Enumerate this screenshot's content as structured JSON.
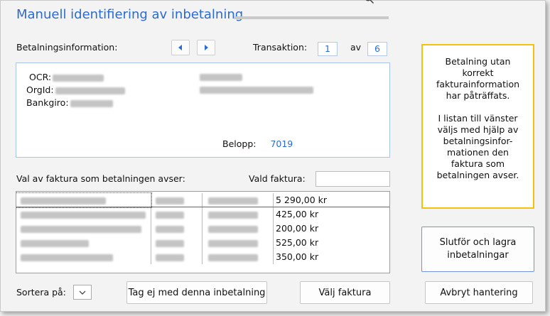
{
  "header": {
    "title": "Manuell identifiering av inbetalning"
  },
  "payment": {
    "section_label": "Betalningsinformation:",
    "transaction_label": "Transaktion:",
    "transaction_current": "1",
    "of_label": "av",
    "transaction_total": "6",
    "ocr_label": "OCR:",
    "orgid_label": "OrgId:",
    "bankgiro_label": "Bankgiro:",
    "amount_label": "Belopp:",
    "amount_value": "7019"
  },
  "invoice_selection": {
    "label": "Val av faktura som betalningen avser:",
    "selected_label": "Vald faktura:",
    "selected_value": "",
    "rows": [
      {
        "amount": "5 290,00 kr",
        "selected": true
      },
      {
        "amount": "425,00 kr"
      },
      {
        "amount": "200,00 kr"
      },
      {
        "amount": "525,00 kr"
      },
      {
        "amount": "350,00 kr"
      }
    ]
  },
  "info_box": {
    "lines": [
      "Betalning utan",
      "korrekt",
      "fakturainformation",
      "har påträffats.",
      "",
      "I listan till vänster",
      "väljs med hjälp av",
      "betalningsinfor-",
      "mationen den",
      "faktura som",
      "betalningen avser."
    ]
  },
  "buttons": {
    "finish_line1": "Slutför och lagra",
    "finish_line2": "inbetalningar",
    "skip": "Tag ej med denna inbetalning",
    "choose": "Välj faktura",
    "cancel": "Avbryt hantering"
  },
  "sort": {
    "label": "Sortera på:"
  },
  "colors": {
    "accent": "#2a6bd1",
    "info_border": "#f4c20d"
  },
  "icons": {
    "prev": "arrow-left-icon",
    "next": "arrow-right-icon",
    "sort": "chevron-down-icon",
    "search": "magnifier-icon"
  }
}
